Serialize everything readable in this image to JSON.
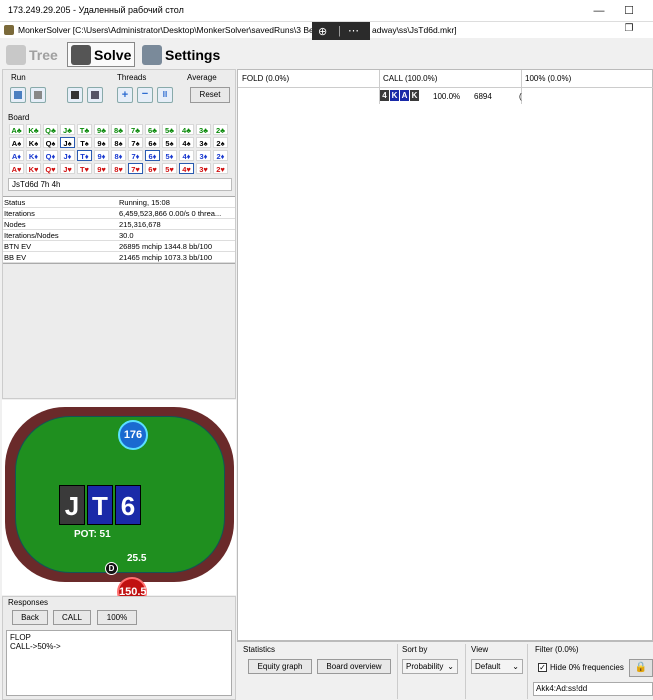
{
  "remote": {
    "title": "173.249.29.205 - Удаленный рабочий стол",
    "minimize": "—",
    "maximize": "☐",
    "close": "✕",
    "zoom_icon": "zoom-icon",
    "more_icon": "more-icon"
  },
  "app": {
    "title": "MonkerSolver [C:\\Users\\Administrator\\Desktop\\MonkerSolver\\savedRuns\\3 Bet",
    "title_tail": "adway\\ss\\JsTd6d.mkr]",
    "restore": "❐",
    "close": "✕"
  },
  "tabs": {
    "tree": "Tree",
    "solve": "Solve",
    "settings": "Settings"
  },
  "controls": {
    "run_label": "Run",
    "threads_label": "Threads",
    "average_label": "Average",
    "reset_label": "Reset",
    "board_label": "Board",
    "plus": "+",
    "minus": "−",
    "pause": "II"
  },
  "board_grid": {
    "rows": [
      {
        "suit": "c",
        "cards": [
          "A♣",
          "K♣",
          "Q♣",
          "J♣",
          "T♣",
          "9♣",
          "8♣",
          "7♣",
          "6♣",
          "5♣",
          "4♣",
          "3♣",
          "2♣"
        ]
      },
      {
        "suit": "s",
        "cards": [
          "A♠",
          "K♠",
          "Q♠",
          "J♠",
          "T♠",
          "9♠",
          "8♠",
          "7♠",
          "6♠",
          "5♠",
          "4♠",
          "3♠",
          "2♠"
        ]
      },
      {
        "suit": "d",
        "cards": [
          "A♦",
          "K♦",
          "Q♦",
          "J♦",
          "T♦",
          "9♦",
          "8♦",
          "7♦",
          "6♦",
          "5♦",
          "4♦",
          "3♦",
          "2♦"
        ]
      },
      {
        "suit": "h",
        "cards": [
          "A♥",
          "K♥",
          "Q♥",
          "J♥",
          "T♥",
          "9♥",
          "8♥",
          "7♥",
          "6♥",
          "5♥",
          "4♥",
          "3♥",
          "2♥"
        ]
      }
    ],
    "selected": [
      "J♠",
      "T♦",
      "6♦",
      "7♥",
      "4♥"
    ]
  },
  "board_text": "JsTd6d 7h 4h",
  "info": [
    {
      "key": "Status",
      "value": "Running, 15:08"
    },
    {
      "key": "Iterations",
      "value": "6,459,523,866  0.00/s 0 threa..."
    },
    {
      "key": "Nodes",
      "value": "215,316,678"
    },
    {
      "key": "Iterations/Nodes",
      "value": "30.0"
    },
    {
      "key": "BTN EV",
      "value": "26895 mchip     1344.8 bb/100"
    },
    {
      "key": "BB EV",
      "value": "21465 mchip     1073.3 bb/100"
    }
  ],
  "table": {
    "top_stack": "176",
    "bottom_stack": "150.5",
    "board_cards": [
      {
        "rank": "J",
        "color": "#3a3a3a"
      },
      {
        "rank": "T",
        "color": "#1a2aa8"
      },
      {
        "rank": "6",
        "color": "#1a2aa8"
      }
    ],
    "pot": "POT: 51",
    "bet": "25.5",
    "dealer": "D"
  },
  "responses": {
    "label": "Responses",
    "back": "Back",
    "call": "CALL",
    "pct": "100%",
    "line1": "FLOP",
    "line2": "CALL->50%->"
  },
  "columns": {
    "fold": "FOLD (0.0%)",
    "call": "CALL (100.0%)",
    "third": "100% (0.0%)"
  },
  "hand_row": {
    "cards": [
      {
        "rank": "4",
        "color": "#3a3a3a"
      },
      {
        "rank": "K",
        "color": "#1a2aa8"
      },
      {
        "rank": "A",
        "color": "#1a2aa8"
      },
      {
        "rank": "K",
        "color": "#3a3a3a"
      }
    ],
    "pct": "100.0%",
    "count": "6894",
    "trail": "("
  },
  "bottom": {
    "statistics_label": "Statistics",
    "equity_graph": "Equity graph",
    "board_overview": "Board overview",
    "sortby_label": "Sort by",
    "sortby_value": "Probability",
    "view_label": "View",
    "view_value": "Default",
    "filter_label": "Filter (0.0%)",
    "hide_label": "Hide 0% frequencies",
    "filter_text": "Akk4:Ad:ss!dd",
    "check": "✓",
    "lock_icon": "lock-icon",
    "arrow": "⌄"
  }
}
